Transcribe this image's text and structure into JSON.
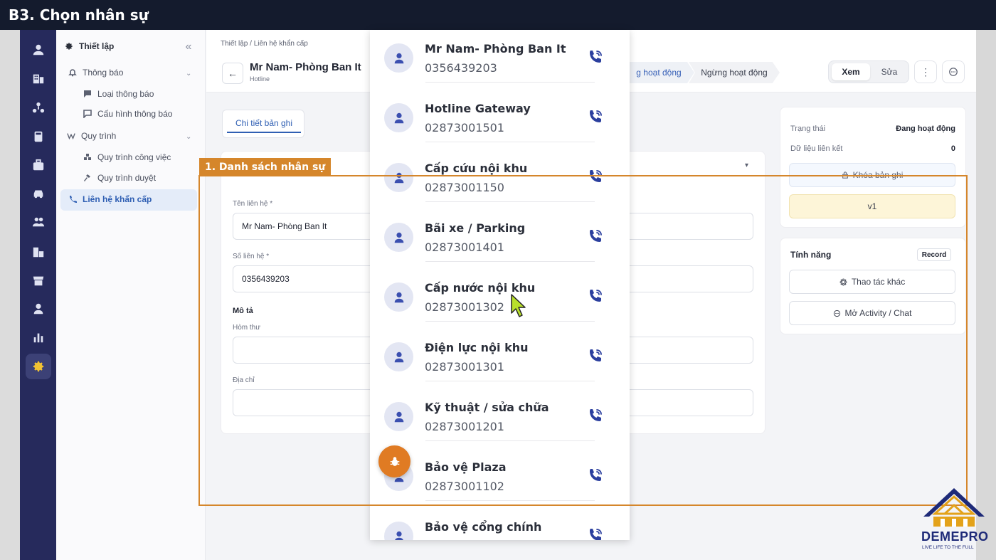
{
  "title_bar": {
    "title": "B3. Chọn nhân sự"
  },
  "icon_rail": {
    "items": [
      "user-icon",
      "building-icon",
      "org-icon",
      "calculator-icon",
      "briefcase-icon",
      "car-icon",
      "users-icon",
      "company-icon",
      "store-icon",
      "person-icon",
      "chart-icon",
      "settings-icon"
    ],
    "active": "settings-icon"
  },
  "sidenav": {
    "header": "Thiết lập",
    "collapse_glyph": "«",
    "items": [
      {
        "label": "Thông báo",
        "icon": "bell-icon"
      },
      {
        "label": "Loại thông báo",
        "icon": "message-icon"
      },
      {
        "label": "Cấu hình thông báo",
        "icon": "chat-config-icon"
      },
      {
        "label": "Quy trình",
        "icon": "workflow-icon"
      },
      {
        "label": "Quy trình công việc",
        "icon": "tasks-icon"
      },
      {
        "label": "Quy trình duyệt",
        "icon": "hammer-icon"
      },
      {
        "label": "Liên hệ khẩn cấp",
        "icon": "phone-icon"
      }
    ]
  },
  "header": {
    "breadcrumb": "Thiết lập  /  Liên hệ khẩn cấp",
    "record_title": "Mr Nam- Phòng Ban It",
    "record_subtitle": "Hotline",
    "stage_active": "g hoạt động",
    "stage_next": "Ngừng hoạt động",
    "view_label": "Xem",
    "edit_label": "Sửa",
    "more_glyph": "⋮"
  },
  "tabs": {
    "detail": "Chi tiết bản ghi"
  },
  "form": {
    "name_label": "Tên liên hệ *",
    "name_value": "Mr Nam- Phòng Ban It",
    "phone_label": "Số liên hệ *",
    "phone_value": "0356439203",
    "section_desc": "Mô tả",
    "mailbox_label": "Hòm thư",
    "address_label": "Địa chỉ",
    "toggle_glyph": "▾"
  },
  "info_panel": {
    "status_label": "Trạng thái",
    "status_value": "Đang hoạt động",
    "linked_label": "Dữ liệu liên kết",
    "linked_value": "0",
    "lock_label": "Khóa bản ghi",
    "version_label": "v1"
  },
  "features": {
    "title": "Tính năng",
    "badge": "Record",
    "other_actions": "Thao tác khác",
    "open_activity": "Mở Activity / Chat"
  },
  "contacts": [
    {
      "name": "Mr Nam- Phòng Ban It",
      "phone": "0356439203"
    },
    {
      "name": "Hotline Gateway",
      "phone": "02873001501"
    },
    {
      "name": "Cấp cứu nội khu",
      "phone": "02873001150"
    },
    {
      "name": "Bãi xe / Parking",
      "phone": "02873001401"
    },
    {
      "name": "Cấp nước nội khu",
      "phone": "02873001302"
    },
    {
      "name": "Điện lực nội khu",
      "phone": "02873001301"
    },
    {
      "name": "Kỹ thuật / sửa chữa",
      "phone": "02873001201"
    },
    {
      "name": "Bảo vệ Plaza",
      "phone": "02873001102"
    },
    {
      "name": "Bảo vệ cổng chính",
      "phone": ""
    }
  ],
  "annotation": {
    "label": "1. Danh sách nhân sự",
    "color": "#d5862b"
  },
  "logo": {
    "brand": "DEMEPRO",
    "slogan": "LIVE LIFE TO THE FULL"
  },
  "colors": {
    "rail": "#262a5c",
    "accent": "#2f5fb3",
    "call_icon": "#2b3f9e",
    "fab": "#e07b23",
    "active_icon": "#f1c233"
  }
}
